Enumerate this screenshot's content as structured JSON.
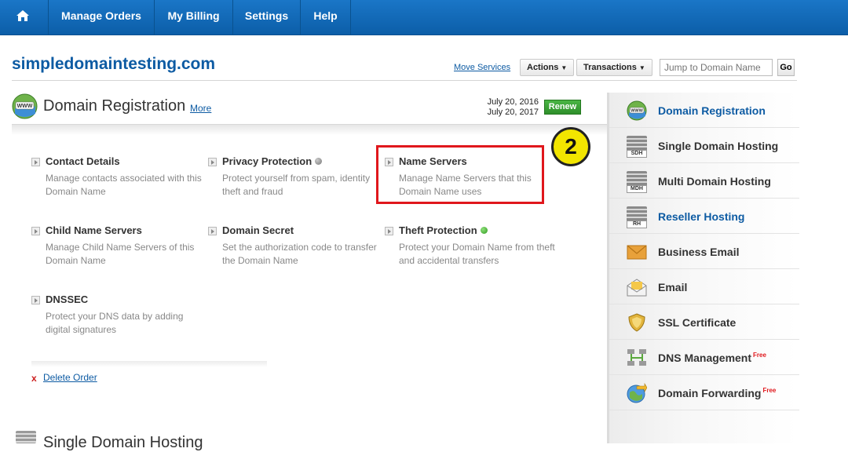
{
  "nav": {
    "items": [
      "Manage Orders",
      "My Billing",
      "Settings",
      "Help"
    ]
  },
  "header": {
    "domain": "simpledomaintesting.com",
    "move_services": "Move Services",
    "actions": "Actions",
    "transactions": "Transactions",
    "jump_placeholder": "Jump to Domain Name",
    "go": "Go"
  },
  "section": {
    "title": "Domain Registration",
    "more": "More",
    "date_start": "July 20, 2016",
    "date_end": "July 20, 2017",
    "renew": "Renew"
  },
  "items": [
    {
      "title": "Contact Details",
      "desc": "Manage contacts associated with this Domain Name"
    },
    {
      "title": "Privacy Protection",
      "desc": "Protect yourself from spam, identity theft and fraud"
    },
    {
      "title": "Name Servers",
      "desc": "Manage Name Servers that this Domain Name uses"
    },
    {
      "title": "Child Name Servers",
      "desc": "Manage Child Name Servers of this Domain Name"
    },
    {
      "title": "Domain Secret",
      "desc": "Set the authorization code to transfer the Domain Name"
    },
    {
      "title": "Theft Protection",
      "desc": "Protect your Domain Name from theft and accidental transfers"
    },
    {
      "title": "DNSSEC",
      "desc": "Protect your DNS data by adding digital signatures"
    }
  ],
  "step_badge": "2",
  "delete": {
    "x": "x",
    "label": "Delete Order"
  },
  "next_section": "Single Domain Hosting",
  "sidebar": {
    "items": [
      {
        "label": "Domain Registration"
      },
      {
        "label": "Single Domain Hosting",
        "badge": "SDH"
      },
      {
        "label": "Multi Domain Hosting",
        "badge": "MDH"
      },
      {
        "label": "Reseller Hosting",
        "badge": "RH"
      },
      {
        "label": "Business Email"
      },
      {
        "label": "Email"
      },
      {
        "label": "SSL Certificate"
      },
      {
        "label": "DNS Management",
        "free": "Free"
      },
      {
        "label": "Domain Forwarding",
        "free": "Free"
      }
    ]
  },
  "colors": {
    "nav_bg": "#1368b8",
    "link": "#0d5ba3",
    "renew": "#3aa535",
    "highlight": "#e0171c",
    "badge": "#f2e500"
  }
}
